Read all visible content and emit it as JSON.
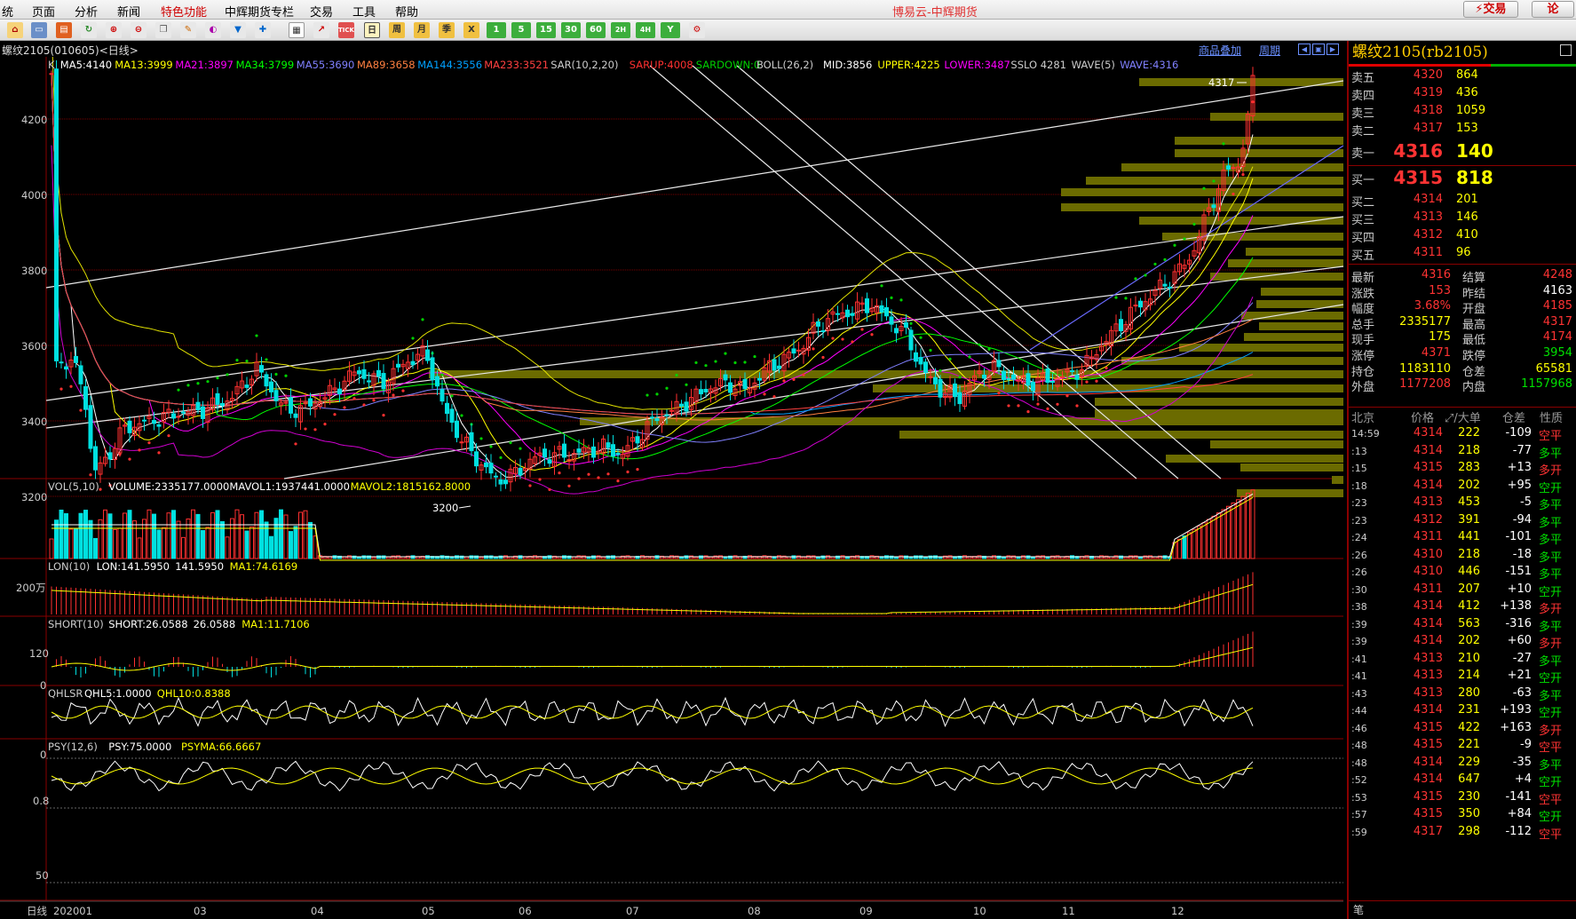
{
  "app": {
    "title": "博易云-中辉期货",
    "trade_button": "⚡交易",
    "lang_button": "论"
  },
  "menu": [
    "统",
    "页面",
    "分析",
    "新闻",
    "特色功能",
    "中辉期货专栏",
    "交易",
    "工具",
    "帮助"
  ],
  "toolbar": {
    "periods": [
      "日",
      "周",
      "月",
      "季",
      "X",
      "1",
      "5",
      "15",
      "30",
      "60",
      "2H",
      "4H",
      "Y"
    ]
  },
  "chart": {
    "symbol_title": "螺纹2105(010605)<日线>",
    "overlay_link": "商品叠加",
    "period_link": "周期",
    "main_indicators": [
      {
        "text": "K",
        "color": "#cccccc"
      },
      {
        "text": "MA5:4140",
        "color": "#ffffff"
      },
      {
        "text": "MA13:3999",
        "color": "#ffff00"
      },
      {
        "text": "MA21:3897",
        "color": "#ff00ff"
      },
      {
        "text": "MA34:3799",
        "color": "#00ff00"
      },
      {
        "text": "MA55:3690",
        "color": "#8080ff"
      },
      {
        "text": "MA89:3658",
        "color": "#ff8040"
      },
      {
        "text": "MA144:3556",
        "color": "#00a0ff"
      },
      {
        "text": "MA233:3521",
        "color": "#ff4040"
      },
      {
        "text": "SAR(10,2,20)",
        "color": "#cccccc"
      },
      {
        "text": "SARUP:4008",
        "color": "#ff3030"
      },
      {
        "text": "SARDOWN:0",
        "color": "#00d000"
      },
      {
        "text": "BOLL(26,2)",
        "color": "#cccccc"
      },
      {
        "text": "MID:3856",
        "color": "#ffffff"
      },
      {
        "text": "UPPER:4225",
        "color": "#ffff00"
      },
      {
        "text": "LOWER:3487",
        "color": "#ff00ff"
      },
      {
        "text": "SSLO 4281",
        "color": "#cccccc"
      },
      {
        "text": "WAVE(5)",
        "color": "#cccccc"
      },
      {
        "text": "WAVE:4316",
        "color": "#8080ff"
      }
    ],
    "price_axis": [
      "4200",
      "4000",
      "3800",
      "3600",
      "3400",
      "3200"
    ],
    "high_marker": "4317",
    "low_marker": "3200",
    "vol_indicators": [
      {
        "text": "VOL(5,10)",
        "color": "#cccccc"
      },
      {
        "text": "VOLUME:2335177.0000",
        "color": "#ffffff"
      },
      {
        "text": "MAVOL1:1937441.0000",
        "color": "#ffffff"
      },
      {
        "text": "MAVOL2:1815162.8000",
        "color": "#ffff00"
      }
    ],
    "vol_axis": "200万",
    "lon_indicators": [
      {
        "text": "LON(10)",
        "color": "#cccccc"
      },
      {
        "text": "LON:141.5950",
        "color": "#ffffff"
      },
      {
        "text": "141.5950",
        "color": "#ffffff"
      },
      {
        "text": "MA1:74.6169",
        "color": "#ffff00"
      }
    ],
    "lon_axis": [
      "120",
      "0"
    ],
    "short_indicators": [
      {
        "text": "SHORT(10)",
        "color": "#cccccc"
      },
      {
        "text": "SHORT:26.0588",
        "color": "#ffffff"
      },
      {
        "text": "26.0588",
        "color": "#ffffff"
      },
      {
        "text": "MA1:11.7106",
        "color": "#ffff00"
      }
    ],
    "short_axis": "0",
    "qhl_indicators": [
      {
        "text": "QHLSR",
        "color": "#cccccc"
      },
      {
        "text": "QHL5:1.0000",
        "color": "#ffffff"
      },
      {
        "text": "QHL10:0.8388",
        "color": "#ffff00"
      }
    ],
    "qhl_axis": "0.8",
    "psy_indicators": [
      {
        "text": "PSY(12,6)",
        "color": "#cccccc"
      },
      {
        "text": "PSY:75.0000",
        "color": "#ffffff"
      },
      {
        "text": "PSYMA:66.6667",
        "color": "#ffff00"
      }
    ],
    "psy_axis": "50",
    "period_label": "日线",
    "date_axis": [
      "202001",
      "03",
      "04",
      "05",
      "06",
      "07",
      "08",
      "09",
      "10",
      "11",
      "12"
    ]
  },
  "quote": {
    "title": "螺纹2105(rb2105)",
    "asks": [
      {
        "label": "卖五",
        "price": "4320",
        "vol": "864"
      },
      {
        "label": "卖四",
        "price": "4319",
        "vol": "436"
      },
      {
        "label": "卖三",
        "price": "4318",
        "vol": "1059"
      },
      {
        "label": "卖二",
        "price": "4317",
        "vol": "153"
      },
      {
        "label": "卖一",
        "price": "4316",
        "vol": "140"
      }
    ],
    "bids": [
      {
        "label": "买一",
        "price": "4315",
        "vol": "818"
      },
      {
        "label": "买二",
        "price": "4314",
        "vol": "201"
      },
      {
        "label": "买三",
        "price": "4313",
        "vol": "146"
      },
      {
        "label": "买四",
        "price": "4312",
        "vol": "410"
      },
      {
        "label": "买五",
        "price": "4311",
        "vol": "96"
      }
    ],
    "stats": [
      {
        "k1": "最新",
        "v1": "4316",
        "c1": "#ff3333",
        "k2": "结算",
        "v2": "4248",
        "c2": "#ff3333"
      },
      {
        "k1": "涨跌",
        "v1": "153",
        "c1": "#ff3333",
        "k2": "昨结",
        "v2": "4163",
        "c2": "#ffffff"
      },
      {
        "k1": "幅度",
        "v1": "3.68%",
        "c1": "#ff3333",
        "k2": "开盘",
        "v2": "4185",
        "c2": "#ff3333"
      },
      {
        "k1": "总手",
        "v1": "2335177",
        "c1": "#ffff00",
        "k2": "最高",
        "v2": "4317",
        "c2": "#ff3333"
      },
      {
        "k1": "现手",
        "v1": "175",
        "c1": "#ffff00",
        "k2": "最低",
        "v2": "4174",
        "c2": "#ff3333"
      },
      {
        "k1": "涨停",
        "v1": "4371",
        "c1": "#ff3333",
        "k2": "跌停",
        "v2": "3954",
        "c2": "#00e000"
      },
      {
        "k1": "持仓",
        "v1": "1183110",
        "c1": "#ffff00",
        "k2": "仓差",
        "v2": "65581",
        "c2": "#ffff00"
      },
      {
        "k1": "外盘",
        "v1": "1177208",
        "c1": "#ff3333",
        "k2": "内盘",
        "v2": "1157968",
        "c2": "#00e000"
      }
    ],
    "tick_header": {
      "time": "北京",
      "price": "价格",
      "vol": "⤢/大单",
      "chg": "仓差",
      "nature": "性质"
    },
    "ticks": [
      {
        "t": "14:59",
        "p": "4314",
        "v": "222",
        "c": "-109",
        "n": "空平",
        "nc": "#ff3333",
        "cc": "#ffffff"
      },
      {
        "t": ":13",
        "p": "4314",
        "v": "218",
        "c": "-77",
        "n": "多平",
        "nc": "#00e000",
        "cc": "#ffffff"
      },
      {
        "t": ":15",
        "p": "4315",
        "v": "283",
        "c": "+13",
        "n": "多开",
        "nc": "#ff3333",
        "cc": "#ffffff"
      },
      {
        "t": ":18",
        "p": "4314",
        "v": "202",
        "c": "+95",
        "n": "空开",
        "nc": "#00e000",
        "cc": "#ffffff"
      },
      {
        "t": ":23",
        "p": "4313",
        "v": "453",
        "c": "-5",
        "n": "多平",
        "nc": "#00e000",
        "cc": "#ffffff"
      },
      {
        "t": ":23",
        "p": "4312",
        "v": "391",
        "c": "-94",
        "n": "多平",
        "nc": "#00e000",
        "cc": "#ffffff"
      },
      {
        "t": ":24",
        "p": "4311",
        "v": "441",
        "c": "-101",
        "n": "多平",
        "nc": "#00e000",
        "cc": "#ffffff"
      },
      {
        "t": ":26",
        "p": "4310",
        "v": "218",
        "c": "-18",
        "n": "多平",
        "nc": "#00e000",
        "cc": "#ffffff"
      },
      {
        "t": ":26",
        "p": "4310",
        "v": "446",
        "c": "-151",
        "n": "多平",
        "nc": "#00e000",
        "cc": "#ffffff"
      },
      {
        "t": ":30",
        "p": "4311",
        "v": "207",
        "c": "+10",
        "n": "空开",
        "nc": "#00e000",
        "cc": "#ffffff"
      },
      {
        "t": ":38",
        "p": "4314",
        "v": "412",
        "c": "+138",
        "n": "多开",
        "nc": "#ff3333",
        "cc": "#ffffff"
      },
      {
        "t": ":39",
        "p": "4314",
        "v": "563",
        "c": "-316",
        "n": "多平",
        "nc": "#00e000",
        "cc": "#ffffff"
      },
      {
        "t": ":39",
        "p": "4314",
        "v": "202",
        "c": "+60",
        "n": "多开",
        "nc": "#ff3333",
        "cc": "#ffffff"
      },
      {
        "t": ":41",
        "p": "4313",
        "v": "210",
        "c": "-27",
        "n": "多平",
        "nc": "#00e000",
        "cc": "#ffffff"
      },
      {
        "t": ":41",
        "p": "4313",
        "v": "214",
        "c": "+21",
        "n": "空开",
        "nc": "#00e000",
        "cc": "#ffffff"
      },
      {
        "t": ":43",
        "p": "4313",
        "v": "280",
        "c": "-63",
        "n": "多平",
        "nc": "#00e000",
        "cc": "#ffffff"
      },
      {
        "t": ":44",
        "p": "4314",
        "v": "231",
        "c": "+193",
        "n": "空开",
        "nc": "#00e000",
        "cc": "#ffffff"
      },
      {
        "t": ":46",
        "p": "4315",
        "v": "422",
        "c": "+163",
        "n": "多开",
        "nc": "#ff3333",
        "cc": "#ffffff"
      },
      {
        "t": ":48",
        "p": "4315",
        "v": "221",
        "c": "-9",
        "n": "空平",
        "nc": "#ff3333",
        "cc": "#ffffff"
      },
      {
        "t": ":48",
        "p": "4314",
        "v": "229",
        "c": "-35",
        "n": "多平",
        "nc": "#00e000",
        "cc": "#ffffff"
      },
      {
        "t": ":52",
        "p": "4314",
        "v": "647",
        "c": "+4",
        "n": "空开",
        "nc": "#00e000",
        "cc": "#ffffff"
      },
      {
        "t": ":53",
        "p": "4315",
        "v": "230",
        "c": "-141",
        "n": "空平",
        "nc": "#ff3333",
        "cc": "#ffffff"
      },
      {
        "t": ":57",
        "p": "4315",
        "v": "350",
        "c": "+84",
        "n": "空开",
        "nc": "#00e000",
        "cc": "#ffffff"
      },
      {
        "t": ":59",
        "p": "4317",
        "v": "298",
        "c": "-112",
        "n": "空平",
        "nc": "#ff3333",
        "cc": "#ffffff"
      }
    ],
    "bottom_label": "笔"
  }
}
